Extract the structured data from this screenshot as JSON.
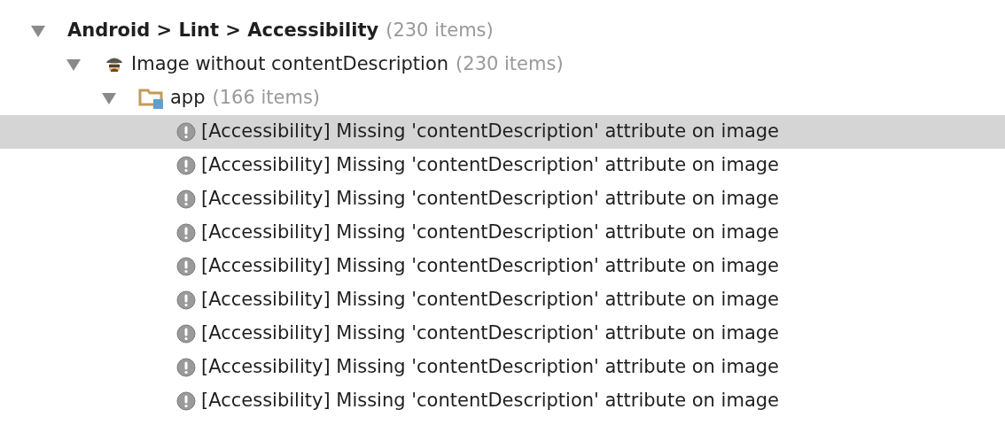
{
  "tree": [
    {
      "kind": "category",
      "label": "Android > Lint > Accessibility",
      "count": "(230 items)",
      "expanded": true,
      "selected": false,
      "children": [
        {
          "kind": "inspection",
          "label": "Image without contentDescription",
          "count": "(230 items)",
          "expanded": true,
          "selected": false,
          "children": [
            {
              "kind": "module",
              "label": "app",
              "count": "(166 items)",
              "expanded": true,
              "selected": false,
              "children": [
                {
                  "kind": "problem",
                  "label": "[Accessibility] Missing 'contentDescription' attribute on image",
                  "selected": true
                },
                {
                  "kind": "problem",
                  "label": "[Accessibility] Missing 'contentDescription' attribute on image",
                  "selected": false
                },
                {
                  "kind": "problem",
                  "label": "[Accessibility] Missing 'contentDescription' attribute on image",
                  "selected": false
                },
                {
                  "kind": "problem",
                  "label": "[Accessibility] Missing 'contentDescription' attribute on image",
                  "selected": false
                },
                {
                  "kind": "problem",
                  "label": "[Accessibility] Missing 'contentDescription' attribute on image",
                  "selected": false
                },
                {
                  "kind": "problem",
                  "label": "[Accessibility] Missing 'contentDescription' attribute on image",
                  "selected": false
                },
                {
                  "kind": "problem",
                  "label": "[Accessibility] Missing 'contentDescription' attribute on image",
                  "selected": false
                },
                {
                  "kind": "problem",
                  "label": "[Accessibility] Missing 'contentDescription' attribute on image",
                  "selected": false
                },
                {
                  "kind": "problem",
                  "label": "[Accessibility] Missing 'contentDescription' attribute on image",
                  "selected": false
                }
              ]
            }
          ]
        }
      ]
    }
  ]
}
